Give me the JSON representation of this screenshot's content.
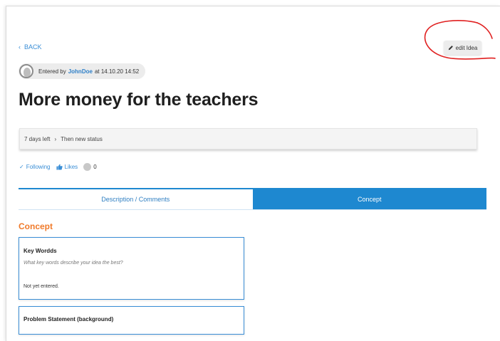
{
  "nav": {
    "back_label": "BACK"
  },
  "actions": {
    "edit_label": "edit Idea"
  },
  "entry": {
    "prefix": "Entered by",
    "user": "JohnDoe",
    "suffix": "at 14.10.20 14:52"
  },
  "idea": {
    "title": "More money for the teachers"
  },
  "status": {
    "days_left": "7 days left",
    "separator": "›",
    "next_status": "Then new status"
  },
  "social": {
    "following_label": "Following",
    "likes_label": "Likes",
    "count": "0"
  },
  "tabs": [
    {
      "label": "Description / Comments",
      "active": false
    },
    {
      "label": "Concept",
      "active": true
    }
  ],
  "concept": {
    "heading": "Concept",
    "cards": [
      {
        "title": "Key Wordds",
        "hint": "What key words describe your idea the best?",
        "value": "Not yet entered."
      },
      {
        "title": "Problem Statement (background)"
      }
    ]
  },
  "colors": {
    "accent": "#1e88d0",
    "link": "#3a8ed6",
    "heading_orange": "#f07a2a",
    "annotation_red": "#e02020"
  },
  "icons": {
    "back": "chevron-left-icon",
    "edit": "pencil-icon",
    "following": "check-icon",
    "likes": "thumbs-up-icon",
    "avatar": "user-avatar"
  }
}
